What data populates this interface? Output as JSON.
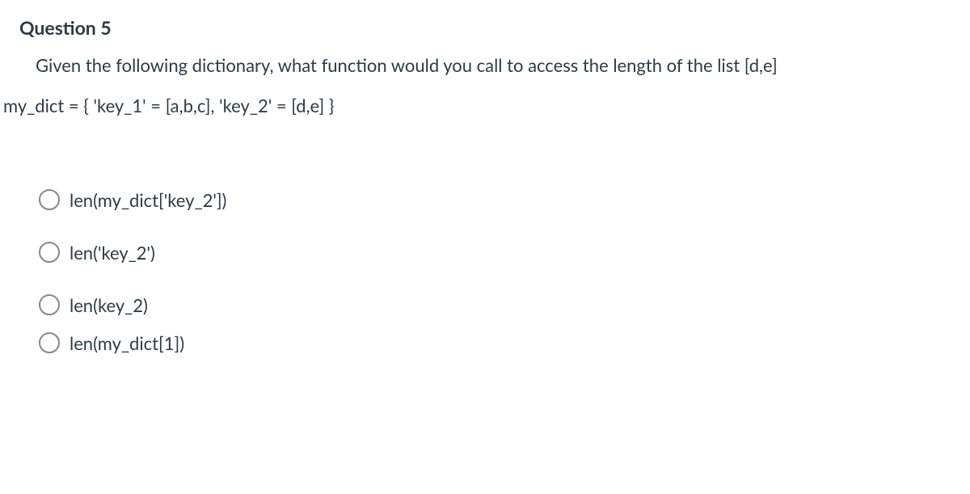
{
  "title": "Question 5",
  "prompt_line1": "Given the following dictionary, what function would you call to access the length of the list [d,e]",
  "code": "my_dict = { 'key_1' = [a,b,c], 'key_2' = [d,e] }",
  "options": [
    {
      "label": "len(my_dict['key_2'])"
    },
    {
      "label": "len('key_2')"
    },
    {
      "label": "len(key_2)"
    },
    {
      "label": "len(my_dict[1])"
    }
  ]
}
